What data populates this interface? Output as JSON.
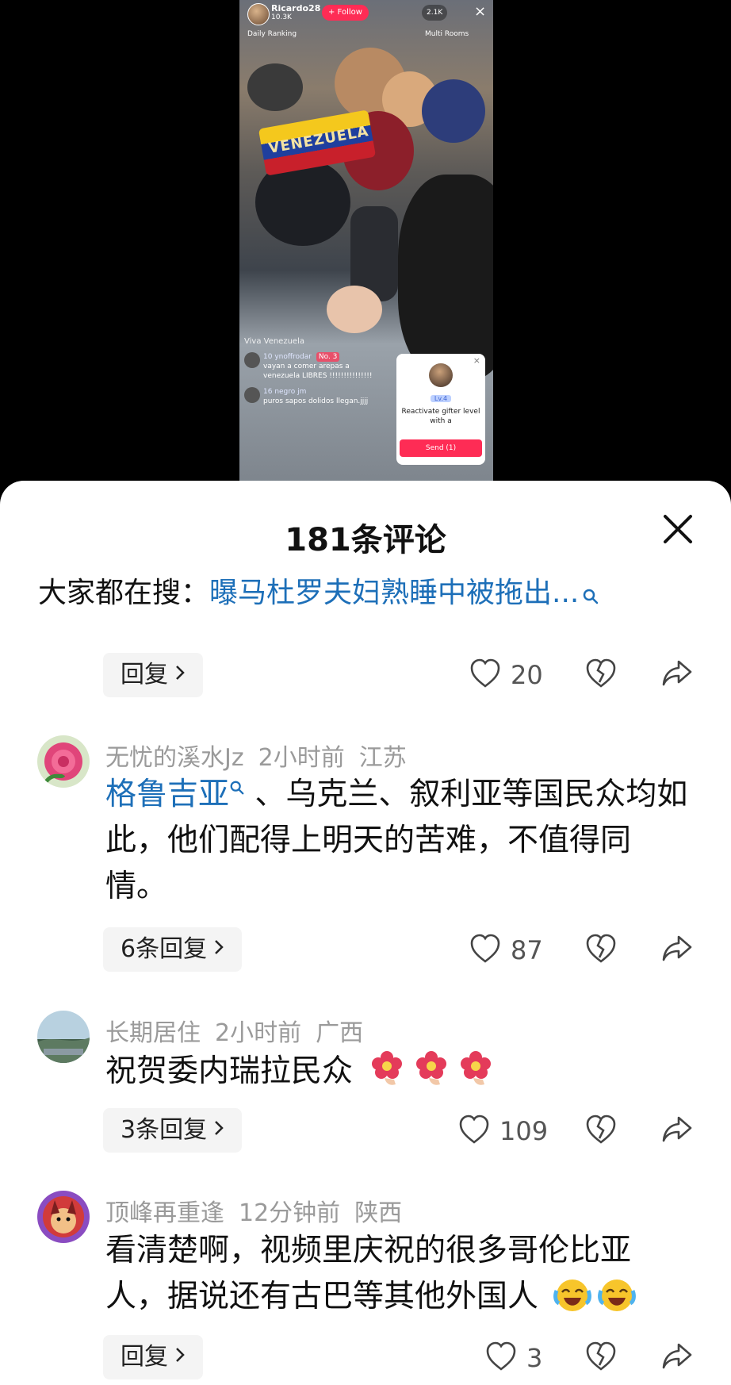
{
  "video": {
    "host_name": "Ricardo28",
    "host_likes": "10.3K",
    "follow_label": "+ Follow",
    "viewer_count": "2.1K",
    "daily_ranking": "Daily Ranking",
    "multi_rooms": "Multi Rooms",
    "flag_text": "VENEZUELA",
    "chat_hint": "Viva Venezuela",
    "chat": [
      {
        "user": "10 ynoffrodar",
        "badge": "No. 3",
        "text": "vayan a comer arepas a venezuela LIBRES !!!!!!!!!!!!!!!"
      },
      {
        "user": "16 negro jm",
        "badge": "",
        "text": "puros sapos dolidos llegan.jjjj"
      }
    ],
    "gift_card": {
      "level": "Lv.4",
      "text": "Reactivate gifter level with a",
      "send_label": "Send (1)"
    }
  },
  "sheet": {
    "title": "181条评论",
    "search_prefix": "大家都在搜：",
    "search_link": "曝马杜罗夫妇熟睡中被拖出..."
  },
  "comments": [
    {
      "reply_label": "回复",
      "likes": "20"
    },
    {
      "username": "无忧的溪水Jz",
      "time": "2小时前",
      "location": "江苏",
      "link": "格鲁吉亚",
      "text": "、乌克兰、叙利亚等国民众均如此，他们配得上明天的苦难，不值得同情。",
      "reply_label": "6条回复",
      "likes": "87"
    },
    {
      "username": "长期居住",
      "time": "2小时前",
      "location": "广西",
      "text": "祝贺委内瑞拉民众",
      "reply_label": "3条回复",
      "likes": "109"
    },
    {
      "username": "顶峰再重逢",
      "time": "12分钟前",
      "location": "陕西",
      "text": "看清楚啊，视频里庆祝的很多哥伦比亚人，据说还有古巴等其他外国人",
      "reply_label": "回复",
      "likes": "3"
    }
  ],
  "icons": {
    "like": "heart-outline-icon",
    "dislike": "broken-heart-icon",
    "share": "share-arrow-icon",
    "close": "close-icon",
    "search": "search-icon"
  },
  "colors": {
    "link": "#1d6fb8",
    "follow": "#fe2c55",
    "meta": "#9a9a9a"
  }
}
